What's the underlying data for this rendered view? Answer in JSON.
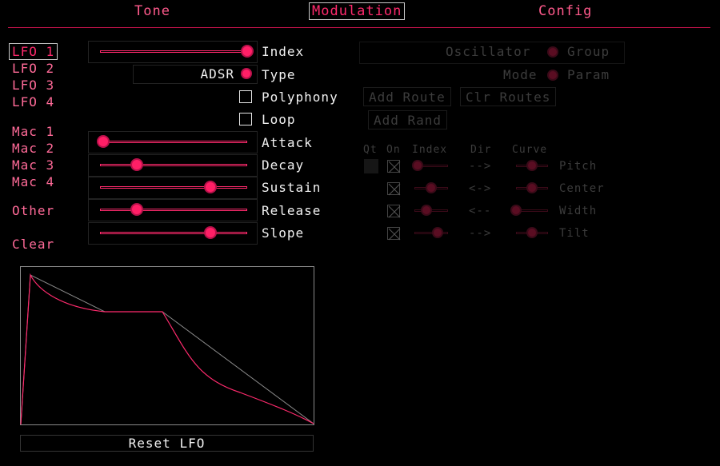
{
  "tabs": [
    "Tone",
    "Modulation",
    "Config"
  ],
  "active_tab": "Modulation",
  "nav": {
    "lfos": [
      "LFO 1",
      "LFO 2",
      "LFO 3",
      "LFO 4"
    ],
    "macros": [
      "Mac 1",
      "Mac 2",
      "Mac 3",
      "Mac 4"
    ],
    "other": "Other",
    "clear": "Clear",
    "selected": "LFO 1"
  },
  "params": {
    "index": {
      "label": "Index",
      "value": 1.0
    },
    "type": {
      "label": "Type",
      "value": "ADSR"
    },
    "polyphony": {
      "label": "Polyphony",
      "checked": false
    },
    "loop": {
      "label": "Loop",
      "checked": false
    },
    "attack": {
      "label": "Attack",
      "value": 0.02
    },
    "decay": {
      "label": "Decay",
      "value": 0.25
    },
    "sustain": {
      "label": "Sustain",
      "value": 0.75
    },
    "release": {
      "label": "Release",
      "value": 0.25
    },
    "slope": {
      "label": "Slope",
      "value": 0.75
    }
  },
  "routing": {
    "oscillator_label": "Oscillator",
    "group_label": "Group",
    "mode_label": "Mode",
    "param_label": "Param",
    "add_route": "Add Route",
    "clr_routes": "Clr Routes",
    "add_rand": "Add Rand",
    "headers": [
      "Qt",
      "On",
      "Index",
      "Dir",
      "Curve"
    ],
    "rows": [
      {
        "dir": "-->",
        "target": "Pitch",
        "index": 0.1,
        "curve": 0.5
      },
      {
        "dir": "<->",
        "target": "Center",
        "index": 0.5,
        "curve": 0.5
      },
      {
        "dir": "<--",
        "target": "Width",
        "index": 0.35,
        "curve": 0.0
      },
      {
        "dir": "-->",
        "target": "Tilt",
        "index": 0.7,
        "curve": 0.5
      }
    ]
  },
  "reset_label": "Reset LFO",
  "colors": {
    "accent": "#ff2a6d",
    "background": "#000000",
    "text": "#f2f2f2",
    "dim": "#3c3c3c"
  }
}
